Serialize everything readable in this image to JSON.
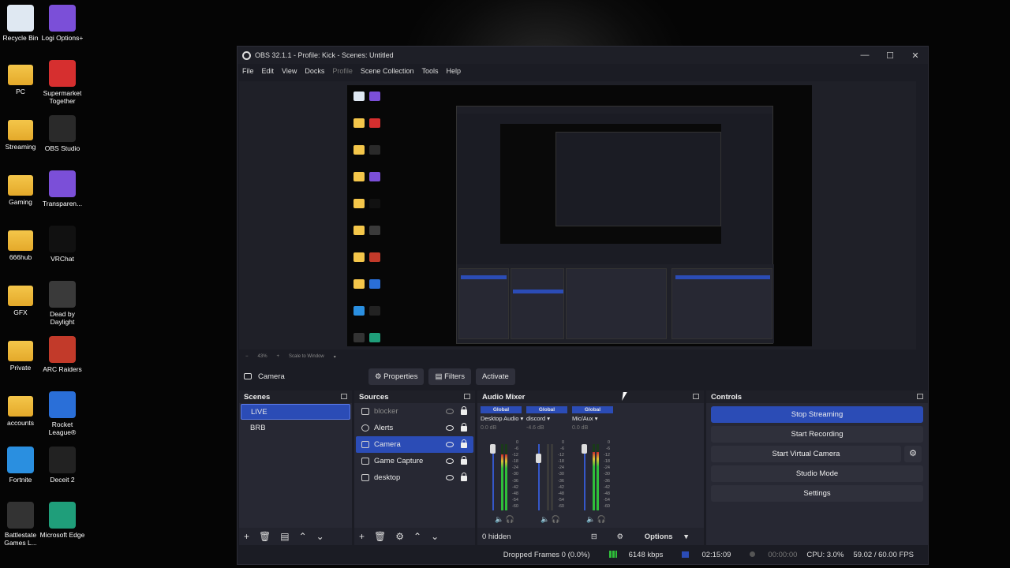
{
  "desktop_icons": [
    {
      "label": "Recycle Bin",
      "icon": "recycle-bin-icon",
      "color": "#dfe8f2",
      "col": 0
    },
    {
      "label": "Logi Options+",
      "icon": "logi-options-icon",
      "color": "#7b4fd8",
      "col": 1
    },
    {
      "label": "PC",
      "icon": "folder-icon",
      "color": "#f4c64a",
      "col": 0
    },
    {
      "label": "Supermarket Together",
      "icon": "supermarket-together-icon",
      "color": "#d62f2f",
      "col": 1
    },
    {
      "label": "Streaming",
      "icon": "folder-icon",
      "color": "#f4c64a",
      "col": 0
    },
    {
      "label": "OBS Studio",
      "icon": "obs-studio-icon",
      "color": "#2a2a2a",
      "col": 1
    },
    {
      "label": "Gaming",
      "icon": "folder-icon",
      "color": "#f4c64a",
      "col": 0
    },
    {
      "label": "Transparen...",
      "icon": "transparency-icon",
      "color": "#7b4fd8",
      "col": 1
    },
    {
      "label": "666hub",
      "icon": "folder-icon",
      "color": "#f4c64a",
      "col": 0
    },
    {
      "label": "VRChat",
      "icon": "vrchat-icon",
      "color": "#111111",
      "col": 1
    },
    {
      "label": "GFX",
      "icon": "folder-icon",
      "color": "#f4c64a",
      "col": 0
    },
    {
      "label": "Dead by Daylight",
      "icon": "dead-by-daylight-icon",
      "color": "#3a3a3a",
      "col": 1
    },
    {
      "label": "Private",
      "icon": "folder-icon",
      "color": "#f4c64a",
      "col": 0
    },
    {
      "label": "ARC Raiders",
      "icon": "arc-raiders-icon",
      "color": "#c23a2a",
      "col": 1
    },
    {
      "label": "accounts",
      "icon": "folder-icon",
      "color": "#f4c64a",
      "col": 0
    },
    {
      "label": "Rocket League®",
      "icon": "rocket-league-icon",
      "color": "#2a6fd8",
      "col": 1
    },
    {
      "label": "Fortnite",
      "icon": "fortnite-icon",
      "color": "#2a8fe0",
      "col": 0
    },
    {
      "label": "Deceit 2",
      "icon": "deceit-2-icon",
      "color": "#222222",
      "col": 1
    },
    {
      "label": "Battlestate Games L...",
      "icon": "battlestate-games-icon",
      "color": "#333333",
      "col": 0
    },
    {
      "label": "Microsoft Edge",
      "icon": "microsoft-edge-icon",
      "color": "#1f9e7a",
      "col": 1
    }
  ],
  "window": {
    "title": "OBS 32.1.1 - Profile: Kick - Scenes: Untitled",
    "minimize": "—",
    "maximize": "☐",
    "close": "✕"
  },
  "menu": [
    "File",
    "Edit",
    "View",
    "Docks",
    "Profile",
    "Scene Collection",
    "Tools",
    "Help"
  ],
  "preview_bottom": {
    "zoom": "43%",
    "scale_mode": "Scale to Window"
  },
  "source_toolbar": {
    "selected_source": "Camera",
    "properties": "Properties",
    "filters": "Filters",
    "activate": "Activate"
  },
  "scenes": {
    "title": "Scenes",
    "items": [
      "LIVE",
      "BRB"
    ],
    "selected": "LIVE"
  },
  "sources": {
    "title": "Sources",
    "items": [
      {
        "name": "blocker",
        "icon": "image-icon",
        "visible": false,
        "locked": true
      },
      {
        "name": "Alerts",
        "icon": "globe-icon",
        "visible": true,
        "locked": true
      },
      {
        "name": "Camera",
        "icon": "camera-icon",
        "visible": true,
        "locked": true
      },
      {
        "name": "Game Capture",
        "icon": "gamepad-icon",
        "visible": true,
        "locked": true
      },
      {
        "name": "desktop",
        "icon": "monitor-icon",
        "visible": true,
        "locked": true
      }
    ],
    "selected": "Camera"
  },
  "mixer": {
    "title": "Audio Mixer",
    "channels": [
      {
        "badge": "Global",
        "name": "Desktop Audio",
        "db": "0.0 dB",
        "level": 0.85
      },
      {
        "badge": "Global",
        "name": "discord",
        "db": "-4.6 dB",
        "level": 0.0
      },
      {
        "badge": "Global",
        "name": "Mic/Aux",
        "db": "0.0 dB",
        "level": 0.88
      }
    ],
    "scale": [
      "0",
      "-6",
      "-12",
      "-18",
      "-24",
      "-30",
      "-36",
      "-42",
      "-48",
      "-54",
      "-60"
    ],
    "hidden_count": "0 hidden",
    "options": "Options"
  },
  "controls": {
    "title": "Controls",
    "stop_streaming": "Stop Streaming",
    "start_recording": "Start Recording",
    "start_virtual_camera": "Start Virtual Camera",
    "studio_mode": "Studio Mode",
    "settings": "Settings"
  },
  "status": {
    "dropped_frames": "Dropped Frames 0 (0.0%)",
    "bitrate": "6148 kbps",
    "stream_time": "02:15:09",
    "record_time": "00:00:00",
    "cpu": "CPU: 3.0%",
    "fps": "59.02 / 60.00 FPS"
  },
  "colors": {
    "accent": "#2b4cb6",
    "panel": "#272833",
    "background": "#1b1c24"
  }
}
